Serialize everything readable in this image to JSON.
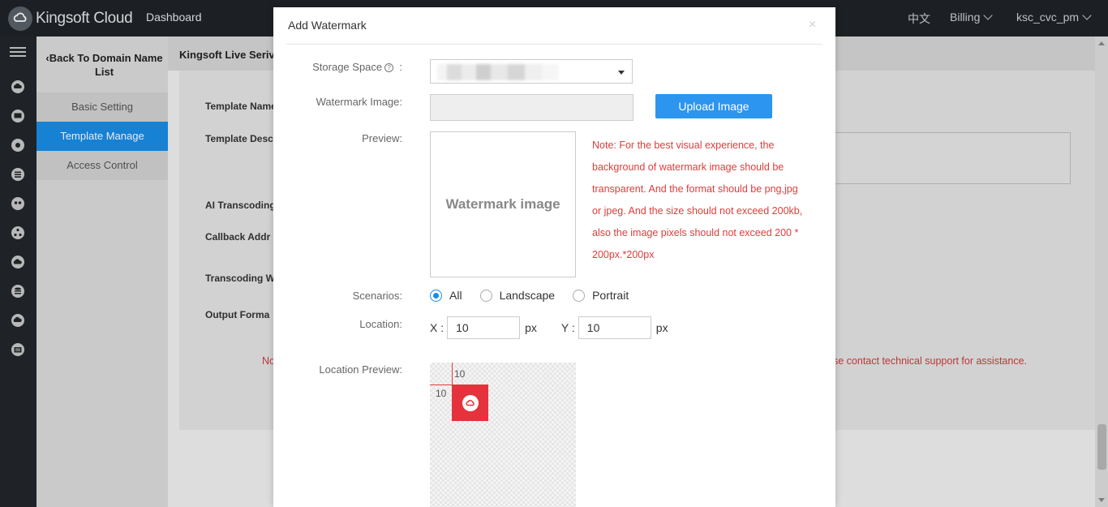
{
  "header": {
    "brand": "Kingsoft Cloud",
    "dashboard": "Dashboard",
    "language": "中文",
    "billing": "Billing",
    "user": "ksc_cvc_pm"
  },
  "sidebar": {
    "back_label": "Back To Domain Name List",
    "items": [
      {
        "label": "Basic Setting"
      },
      {
        "label": "Template Manage",
        "active": true
      },
      {
        "label": "Access Control"
      }
    ]
  },
  "main": {
    "title": "Kingsoft Live Serivce",
    "labels": [
      "Template Name",
      "Template Desc",
      "AI Transcoding",
      "Callback Addr",
      "Transcoding W",
      "Output Forma"
    ],
    "notice_left": "No",
    "notice_right": "se contact technical support for assistance."
  },
  "modal": {
    "title": "Add Watermark",
    "close": "×",
    "storage_label": "Storage Space",
    "storage_suffix": ":",
    "watermark_label": "Watermark Image:",
    "upload_button": "Upload Image",
    "preview_label": "Preview:",
    "preview_placeholder": "Watermark image",
    "note": "Note: For the best visual experience, the background of watermark image should be transparent. And the format should be png,jpg or jpeg. And the size should not exceed 200kb, also the image pixels should not exceed 200 * 200px.*200px",
    "scenarios_label": "Scenarios:",
    "scenarios": [
      {
        "label": "All",
        "checked": true
      },
      {
        "label": "Landscape",
        "checked": false
      },
      {
        "label": "Portrait",
        "checked": false
      }
    ],
    "location_label": "Location:",
    "x_label": "X :",
    "x_value": "10",
    "y_label": "Y :",
    "y_value": "10",
    "unit": "px",
    "location_preview_label": "Location Preview:",
    "guide_x": "10",
    "guide_y": "10"
  },
  "colors": {
    "accent": "#1a8ce6",
    "button": "#2b95f0",
    "warning": "#e03c3c",
    "brand_red": "#e5333d",
    "topbar": "#1f2329"
  }
}
